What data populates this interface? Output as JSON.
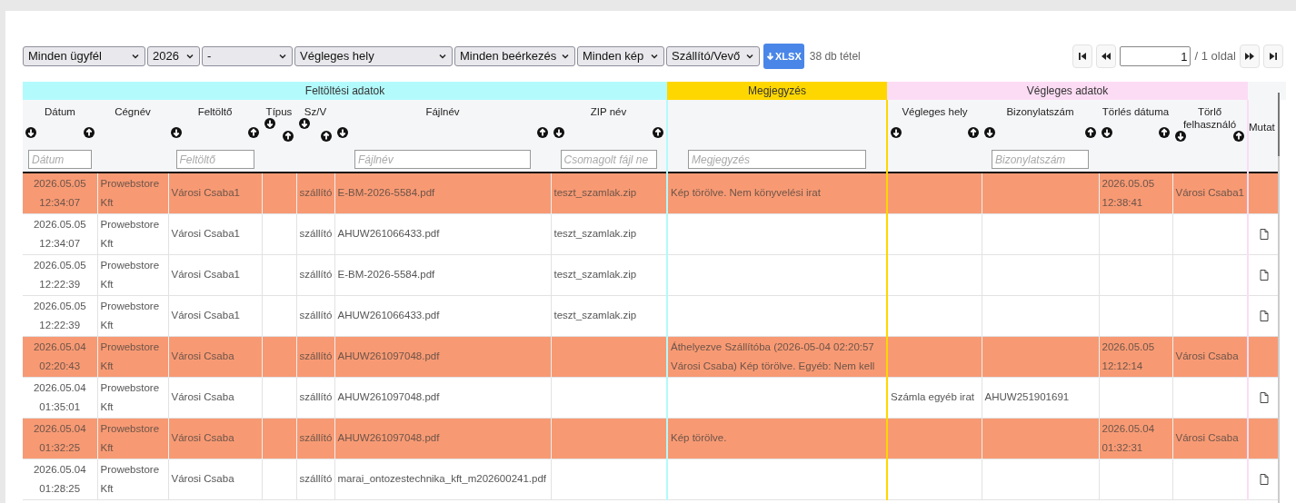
{
  "toolbar": {
    "selects": [
      {
        "value": "Minden ügyfél"
      },
      {
        "value": "2026"
      },
      {
        "value": "-"
      },
      {
        "value": "Végleges hely"
      },
      {
        "value": "Minden beérkezés"
      },
      {
        "value": "Minden kép"
      },
      {
        "value": "Szállító/Vevő"
      }
    ],
    "export_button": "XLSX",
    "item_count": "38 db tétel",
    "pagination": {
      "page": "1",
      "total": "/ 1 oldal"
    }
  },
  "table": {
    "groups": [
      {
        "label": "Feltöltési adatok",
        "color": "#b3fafc",
        "columns": [
          {
            "label": "Dátum",
            "sortable": true,
            "placeholder": "Dátum"
          },
          {
            "label": "Cégnév",
            "sortable": false
          },
          {
            "label": "Feltöltő",
            "sortable": true,
            "placeholder": "Feltöltő"
          },
          {
            "label": "Típus",
            "sortable": true
          },
          {
            "label": "Sz/V",
            "sortable": true
          },
          {
            "label": "Fájlnév",
            "sortable": true,
            "placeholder": "Fájlnév"
          },
          {
            "label": "ZIP név",
            "sortable": true,
            "placeholder": "Csomagolt fájl ne"
          }
        ]
      },
      {
        "label": "Megjegyzés",
        "color": "#ffd700",
        "columns": [
          {
            "sortable": false,
            "placeholder": "Megjegyzés"
          }
        ]
      },
      {
        "label": "Végleges adatok",
        "color": "#fcdcf4",
        "columns": [
          {
            "label": "Végleges hely",
            "sortable": true
          },
          {
            "label": "Bizonylatszám",
            "sortable": true,
            "placeholder": "Bizonylatszám"
          },
          {
            "label": "Törlés dátuma",
            "sortable": true
          },
          {
            "label": "Törlő felhasználó",
            "sortable": true
          }
        ]
      }
    ],
    "extra_column": {
      "label": "Mutat"
    },
    "rows": [
      {
        "deleted": true,
        "cells": [
          "2026.05.05 12:34:07",
          "Prowebstore Kft",
          "Városi Csaba1",
          null,
          "szállító",
          "E-BM-2026-5584.pdf",
          "teszt_szamlak.zip",
          "Kép törölve. Nem könyvelési irat",
          null,
          null,
          "2026.05.05 12:38:41",
          "Városi Csaba1"
        ]
      },
      {
        "deleted": false,
        "cells": [
          "2026.05.05 12:34:07",
          "Prowebstore Kft",
          "Városi Csaba1",
          null,
          "szállító",
          "AHUW261066433.pdf",
          "teszt_szamlak.zip",
          null,
          null,
          null,
          null,
          null
        ]
      },
      {
        "deleted": false,
        "cells": [
          "2026.05.05 12:22:39",
          "Prowebstore Kft",
          "Városi Csaba1",
          null,
          "szállító",
          "E-BM-2026-5584.pdf",
          "teszt_szamlak.zip",
          null,
          null,
          null,
          null,
          null
        ]
      },
      {
        "deleted": false,
        "cells": [
          "2026.05.05 12:22:39",
          "Prowebstore Kft",
          "Városi Csaba1",
          null,
          "szállító",
          "AHUW261066433.pdf",
          "teszt_szamlak.zip",
          null,
          null,
          null,
          null,
          null
        ]
      },
      {
        "deleted": true,
        "cells": [
          "2026.05.04 02:20:43",
          "Prowebstore Kft",
          "Városi Csaba",
          null,
          "szállító",
          "AHUW261097048.pdf",
          null,
          "Áthelyezve Szállítóba (2026-05-04 02:20:57 Városi Csaba) Kép törölve. Egyéb: Nem kell",
          null,
          null,
          "2026.05.05 12:12:14",
          "Városi Csaba"
        ]
      },
      {
        "deleted": false,
        "cells": [
          "2026.05.04 01:35:01",
          "Prowebstore Kft",
          "Városi Csaba",
          null,
          "szállító",
          "AHUW261097048.pdf",
          null,
          null,
          "Számla egyéb irat",
          "AHUW251901691",
          null,
          null
        ]
      },
      {
        "deleted": true,
        "cells": [
          "2026.05.04 01:32:25",
          "Prowebstore Kft",
          "Városi Csaba",
          null,
          "szállító",
          "AHUW261097048.pdf",
          null,
          "Kép törölve.",
          null,
          null,
          "2026.05.04 01:32:31",
          "Városi Csaba"
        ]
      },
      {
        "deleted": false,
        "cells": [
          "2026.05.04 01:28:25",
          "Prowebstore Kft",
          "Városi Csaba",
          null,
          "szállító",
          "marai_ontozestechnika_kft_m202600241.pdf",
          null,
          null,
          null,
          null,
          null,
          null
        ]
      }
    ]
  }
}
